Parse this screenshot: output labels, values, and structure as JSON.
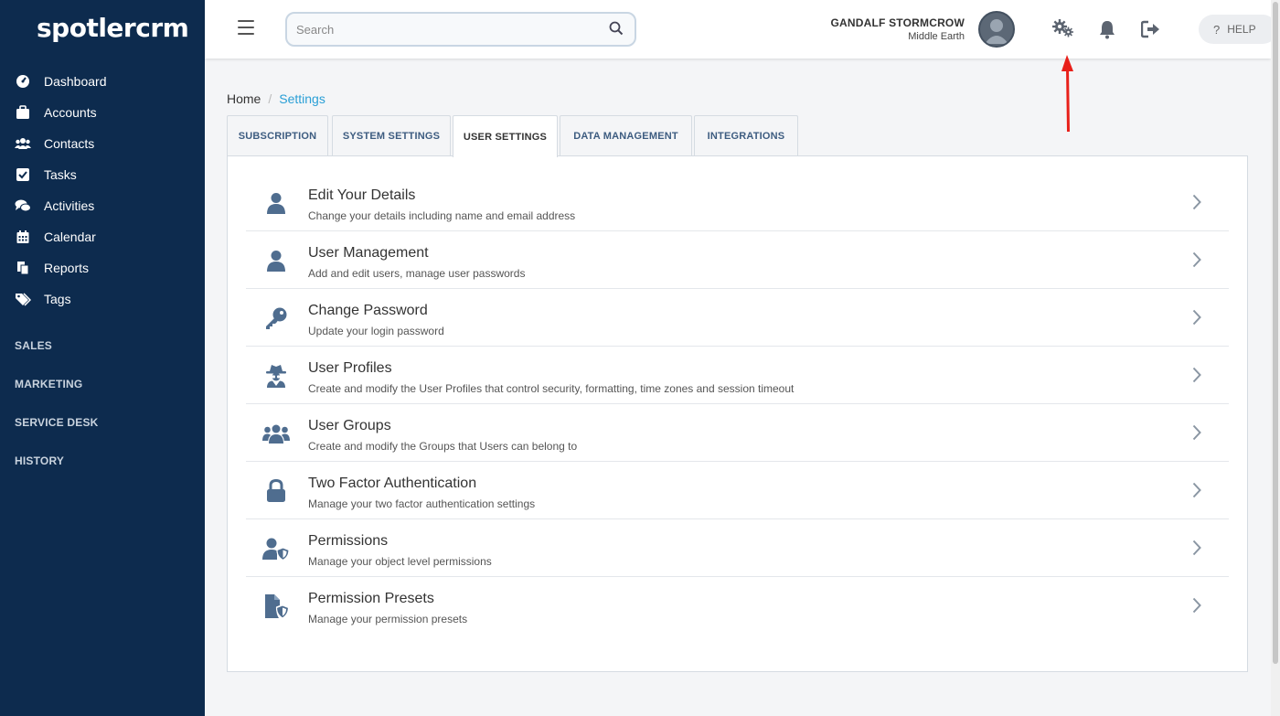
{
  "app": {
    "logo": "spotlercrm"
  },
  "sidebar": {
    "items": [
      {
        "label": "Dashboard",
        "icon": "dashboard-icon"
      },
      {
        "label": "Accounts",
        "icon": "briefcase-icon"
      },
      {
        "label": "Contacts",
        "icon": "users-icon"
      },
      {
        "label": "Tasks",
        "icon": "checkbox-icon"
      },
      {
        "label": "Activities",
        "icon": "comments-icon"
      },
      {
        "label": "Calendar",
        "icon": "calendar-icon"
      },
      {
        "label": "Reports",
        "icon": "copy-icon"
      },
      {
        "label": "Tags",
        "icon": "tags-icon"
      }
    ],
    "sections": [
      "SALES",
      "MARKETING",
      "SERVICE DESK",
      "HISTORY"
    ]
  },
  "topbar": {
    "search_placeholder": "Search",
    "user_name": "GANDALF STORMCROW",
    "user_location": "Middle Earth",
    "help_label": "HELP"
  },
  "breadcrumb": {
    "home": "Home",
    "current": "Settings"
  },
  "tabs": [
    {
      "label": "SUBSCRIPTION",
      "active": false
    },
    {
      "label": "SYSTEM SETTINGS",
      "active": false
    },
    {
      "label": "USER SETTINGS",
      "active": true
    },
    {
      "label": "DATA MANAGEMENT",
      "active": false
    },
    {
      "label": "INTEGRATIONS",
      "active": false
    }
  ],
  "settings": [
    {
      "title": "Edit Your Details",
      "desc": "Change your details including name and email address",
      "icon": "user-icon"
    },
    {
      "title": "User Management",
      "desc": "Add and edit users, manage user passwords",
      "icon": "user-icon"
    },
    {
      "title": "Change Password",
      "desc": "Update your login password",
      "icon": "key-icon"
    },
    {
      "title": "User Profiles",
      "desc": "Create and modify the User Profiles that control security, formatting, time zones and session timeout",
      "icon": "user-secret-icon"
    },
    {
      "title": "User Groups",
      "desc": "Create and modify the Groups that Users can belong to",
      "icon": "users-icon"
    },
    {
      "title": "Two Factor Authentication",
      "desc": "Manage your two factor authentication settings",
      "icon": "lock-icon"
    },
    {
      "title": "Permissions",
      "desc": "Manage your object level permissions",
      "icon": "user-shield-icon"
    },
    {
      "title": "Permission Presets",
      "desc": "Manage your permission presets",
      "icon": "file-shield-icon"
    }
  ],
  "colors": {
    "sidebar": "#0d2b4e",
    "accent": "#2a9fd6",
    "icon": "#4f6d8f",
    "annotation": "#e8201a"
  }
}
